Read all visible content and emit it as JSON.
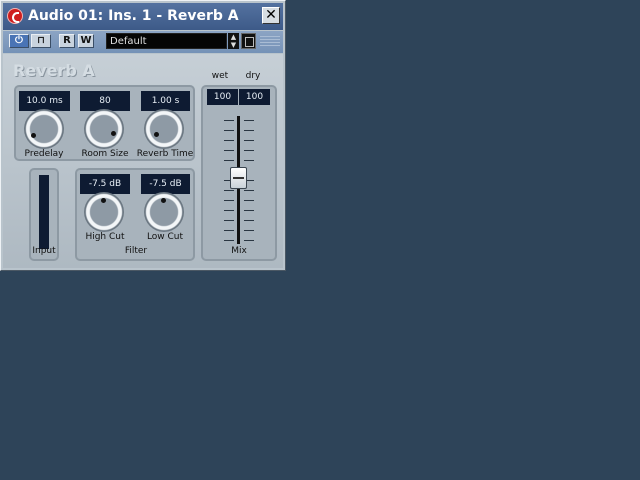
{
  "window": {
    "title": "Audio 01: Ins. 1 - Reverb A",
    "close_glyph": "✕"
  },
  "toolbar": {
    "power_glyph": "⏻",
    "bypass_glyph": "⊓",
    "read_label": "R",
    "write_label": "W",
    "preset_value": "Default",
    "spin_up": "▲",
    "spin_down": "▼"
  },
  "plugin": {
    "name": "Reverb A",
    "params": {
      "predelay": {
        "label": "Predelay",
        "value": "10.0 ms"
      },
      "room_size": {
        "label": "Room Size",
        "value": "80"
      },
      "reverb_time": {
        "label": "Reverb Time",
        "value": "1.00 s"
      }
    },
    "input_label": "Input",
    "filter": {
      "label": "Filter",
      "high_cut": {
        "label": "High Cut",
        "value": "-7.5 dB"
      },
      "low_cut": {
        "label": "Low Cut",
        "value": "-7.5 dB"
      }
    },
    "mix": {
      "label": "Mix",
      "wet_label": "wet",
      "dry_label": "dry",
      "wet_value": "100",
      "dry_value": "100"
    }
  },
  "colors": {
    "desktop": "#2e4459",
    "title_bar": "#3d5a88",
    "lcd_background": "#0e1b32"
  }
}
